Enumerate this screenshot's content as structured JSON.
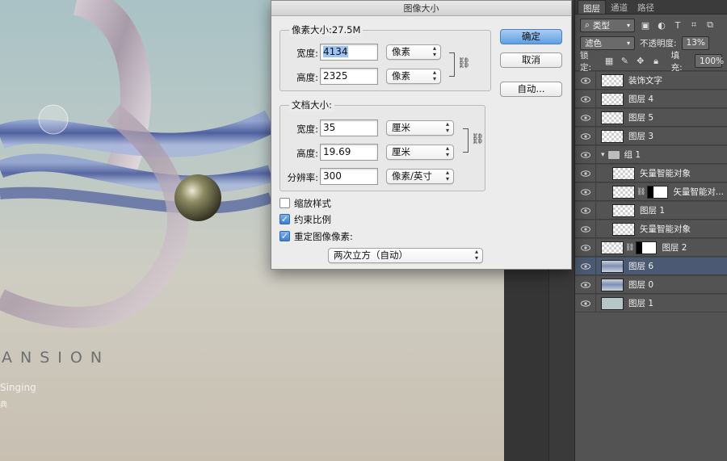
{
  "canvas": {
    "text_main": "ANSION",
    "text_sub": "Singing",
    "text_small": "典"
  },
  "dialog": {
    "title": "图像大小",
    "pixel_size_title": "像素大小:27.5M",
    "pixel_width_label": "宽度:",
    "pixel_width_value": "4134",
    "pixel_width_unit": "像素",
    "pixel_height_label": "高度:",
    "pixel_height_value": "2325",
    "pixel_height_unit": "像素",
    "doc_size_title": "文档大小:",
    "doc_width_label": "宽度:",
    "doc_width_value": "35",
    "doc_width_unit": "厘米",
    "doc_height_label": "高度:",
    "doc_height_value": "19.69",
    "doc_height_unit": "厘米",
    "resolution_label": "分辨率:",
    "resolution_value": "300",
    "resolution_unit": "像素/英寸",
    "ok_label": "确定",
    "cancel_label": "取消",
    "auto_label": "自动...",
    "scale_styles_label": "缩放样式",
    "scale_styles_checked": false,
    "constrain_label": "约束比例",
    "constrain_checked": true,
    "resample_label": "重定图像像素:",
    "resample_checked": true,
    "resample_method": "两次立方（自动）"
  },
  "layers_panel": {
    "tabs": [
      "图层",
      "通道",
      "路径"
    ],
    "active_tab": "图层",
    "filter_kind": "类型",
    "blend_mode": "滤色",
    "opacity_label": "不透明度:",
    "opacity_value": "13%",
    "lock_label": "锁定:",
    "fill_label": "填充:",
    "fill_value": "100%",
    "layers": [
      {
        "name": "装饰文字",
        "indent": 0
      },
      {
        "name": "图层 4",
        "indent": 0
      },
      {
        "name": "图层 5",
        "indent": 0
      },
      {
        "name": "图层 3",
        "indent": 0
      },
      {
        "name": "组 1",
        "indent": 0,
        "group": true
      },
      {
        "name": "矢量智能对象",
        "indent": 1
      },
      {
        "name": "矢量智能对...",
        "indent": 1,
        "mask": true
      },
      {
        "name": "图层 1",
        "indent": 1
      },
      {
        "name": "矢量智能对象",
        "indent": 1
      },
      {
        "name": "图层 2",
        "indent": 0,
        "mask": true
      },
      {
        "name": "图层 6",
        "indent": 0,
        "selected": true
      },
      {
        "name": "图层 0",
        "indent": 0
      },
      {
        "name": "图层 1",
        "indent": 0
      }
    ]
  },
  "colors": {
    "accent": "#5f9fe3",
    "selected_layer": "#4b5a72",
    "panel_bg": "#535353"
  }
}
